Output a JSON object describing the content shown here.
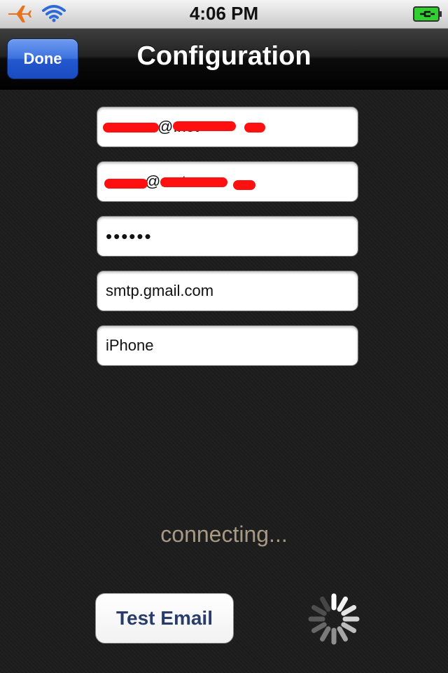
{
  "status_bar": {
    "time": "4:06 PM",
    "icons": [
      "airplane-icon",
      "wifi-icon",
      "battery-charging-icon"
    ],
    "battery_color": "#2fd12f"
  },
  "nav_bar": {
    "done_label": "Done",
    "title": "Configuration"
  },
  "form": {
    "fields": [
      {
        "value": "@.net",
        "redacted": true
      },
      {
        "value": "@.net",
        "redacted": true
      },
      {
        "value": "••••••",
        "type": "password"
      },
      {
        "value": "smtp.gmail.com"
      },
      {
        "value": "iPhone"
      }
    ]
  },
  "connection_status": "connecting...",
  "test_email_label": "Test Email",
  "colors": {
    "accent": "#2358d0",
    "status_text": "#a89a82",
    "button_text": "#2a3d6a",
    "redaction": "#ff1010"
  }
}
